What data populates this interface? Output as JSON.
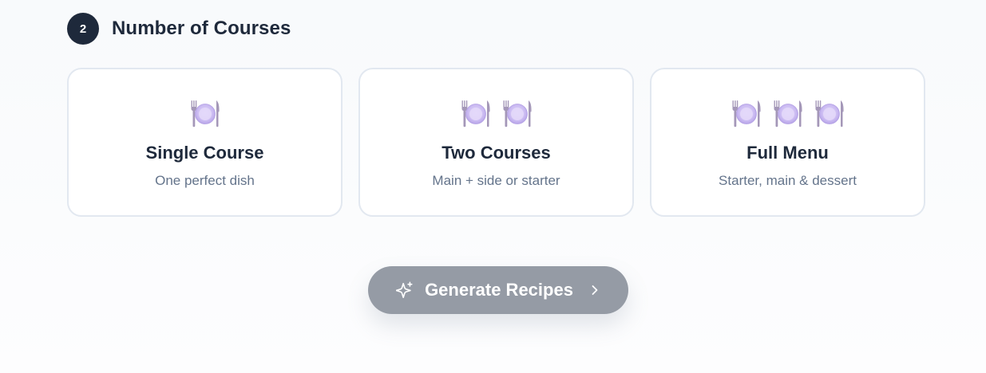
{
  "section": {
    "step": "2",
    "title": "Number of Courses"
  },
  "options": [
    {
      "title": "Single Course",
      "subtitle": "One perfect dish",
      "icon": "fork-knife-plate-icon",
      "icon_count": 1
    },
    {
      "title": "Two Courses",
      "subtitle": "Main + side or starter",
      "icon": "fork-knife-plate-icon",
      "icon_count": 2
    },
    {
      "title": "Full Menu",
      "subtitle": "Starter, main & dessert",
      "icon": "fork-knife-plate-icon",
      "icon_count": 3
    }
  ],
  "generate_button": {
    "label": "Generate Recipes",
    "leading_icon": "sparkle-icon",
    "trailing_icon": "chevron-right-icon",
    "background": "#959ba5"
  },
  "colors": {
    "badge": "#1e293b",
    "card_border": "#e2e8f0",
    "plate": "#c9b8f0",
    "cutlery": "#a497b8"
  }
}
